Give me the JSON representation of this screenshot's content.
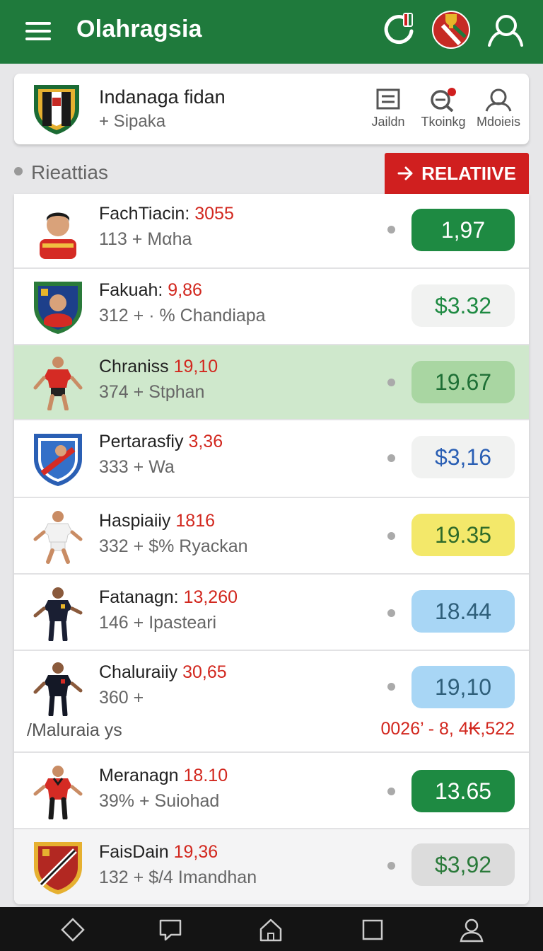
{
  "header": {
    "title": "Olahragsia",
    "icons": [
      "menu-icon",
      "refresh-icon",
      "trophy-badge-icon",
      "user-icon"
    ]
  },
  "team": {
    "name": "Indanaga fidan",
    "sub": "+ Sipaka",
    "actions": [
      {
        "label": "Jaildn",
        "icon": "list-icon"
      },
      {
        "label": "Tkoinkg",
        "icon": "search-notify-icon"
      },
      {
        "label": "Mdoieis",
        "icon": "profile-icon"
      }
    ]
  },
  "section": {
    "title": "Rieattias",
    "button": "RELATIIVE"
  },
  "players": [
    {
      "name": "FachTiacin:",
      "num": "3055",
      "meta": "113 + Mαha",
      "odds": "1,97"
    },
    {
      "name": "Fakuah:",
      "num": "9,86",
      "meta": "312 + · % Chandiapa",
      "odds": "$3.32"
    },
    {
      "name": "Chraniss",
      "num": "19,10",
      "meta": "374 + Stphan",
      "odds": "19.67"
    },
    {
      "name": "Pertarasfiy",
      "num": "3,36",
      "meta": "333 + Wa",
      "odds": "$3,16"
    },
    {
      "name": "Hasрiaiiy",
      "num": "1816",
      "meta": "332 + $% Ryackan",
      "odds": "19.35"
    },
    {
      "name": "Fatanagn:",
      "num": "13,260",
      "meta": "146 + Ipasteari",
      "odds": "18.44"
    },
    {
      "name": "Chaluraiiy",
      "num": "30,65",
      "meta": "360 +",
      "odds": "19,10",
      "extra_left": "/Maluraia ys",
      "extra_right": "0026’ - 8, 4₭,522"
    },
    {
      "name": "Meranagn",
      "num": "18.10",
      "meta": "39% + Suiohad",
      "odds": "13.65"
    },
    {
      "name": "FaisDain",
      "num": "19,36",
      "meta": "132 + $/4 Imandhan",
      "odds": "$3,92"
    }
  ],
  "colors": {
    "brand_green": "#1f7a3c",
    "accent_red": "#d01f1f",
    "highlight_row": "#cfe8cc"
  },
  "bottom_nav": [
    "back-icon",
    "chat-icon",
    "home-icon",
    "square-icon",
    "account-icon"
  ]
}
